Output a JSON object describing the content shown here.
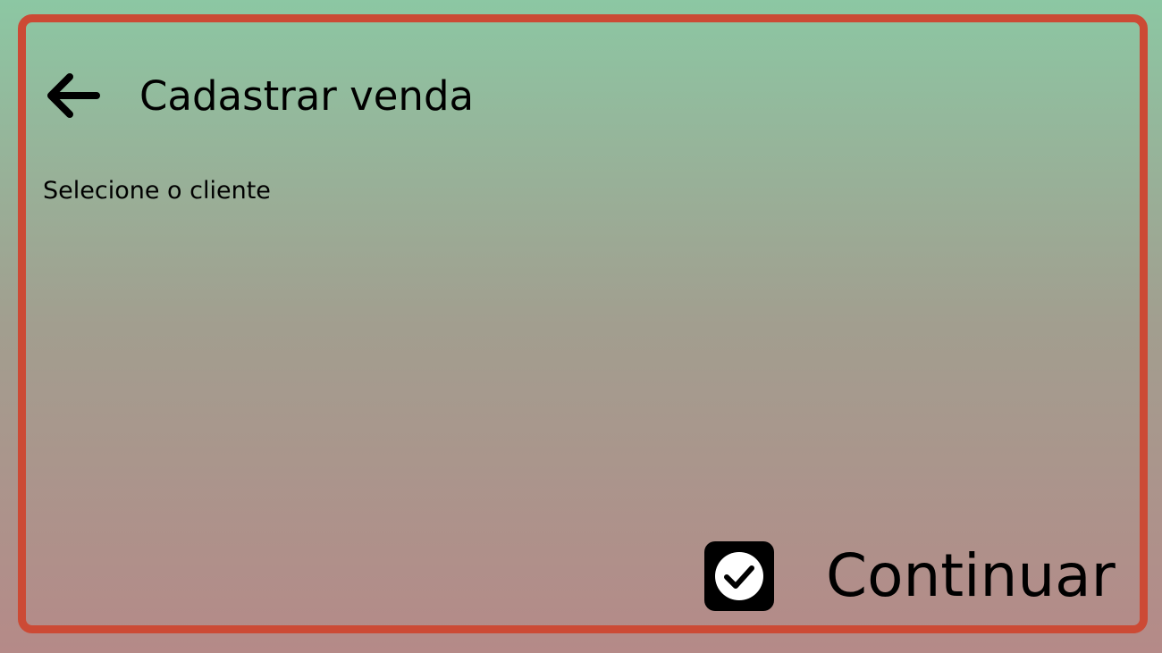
{
  "header": {
    "back_icon": "arrow-left-icon",
    "title": "Cadastrar venda"
  },
  "main": {
    "instruction": "Selecione o cliente"
  },
  "footer": {
    "continue_icon": "checkbox-checked-icon",
    "continue_label": "Continuar"
  },
  "colors": {
    "border": "#cc4a35",
    "gradient_top": "#8cc7a3",
    "gradient_bottom": "#b58a88",
    "text": "#000000"
  }
}
